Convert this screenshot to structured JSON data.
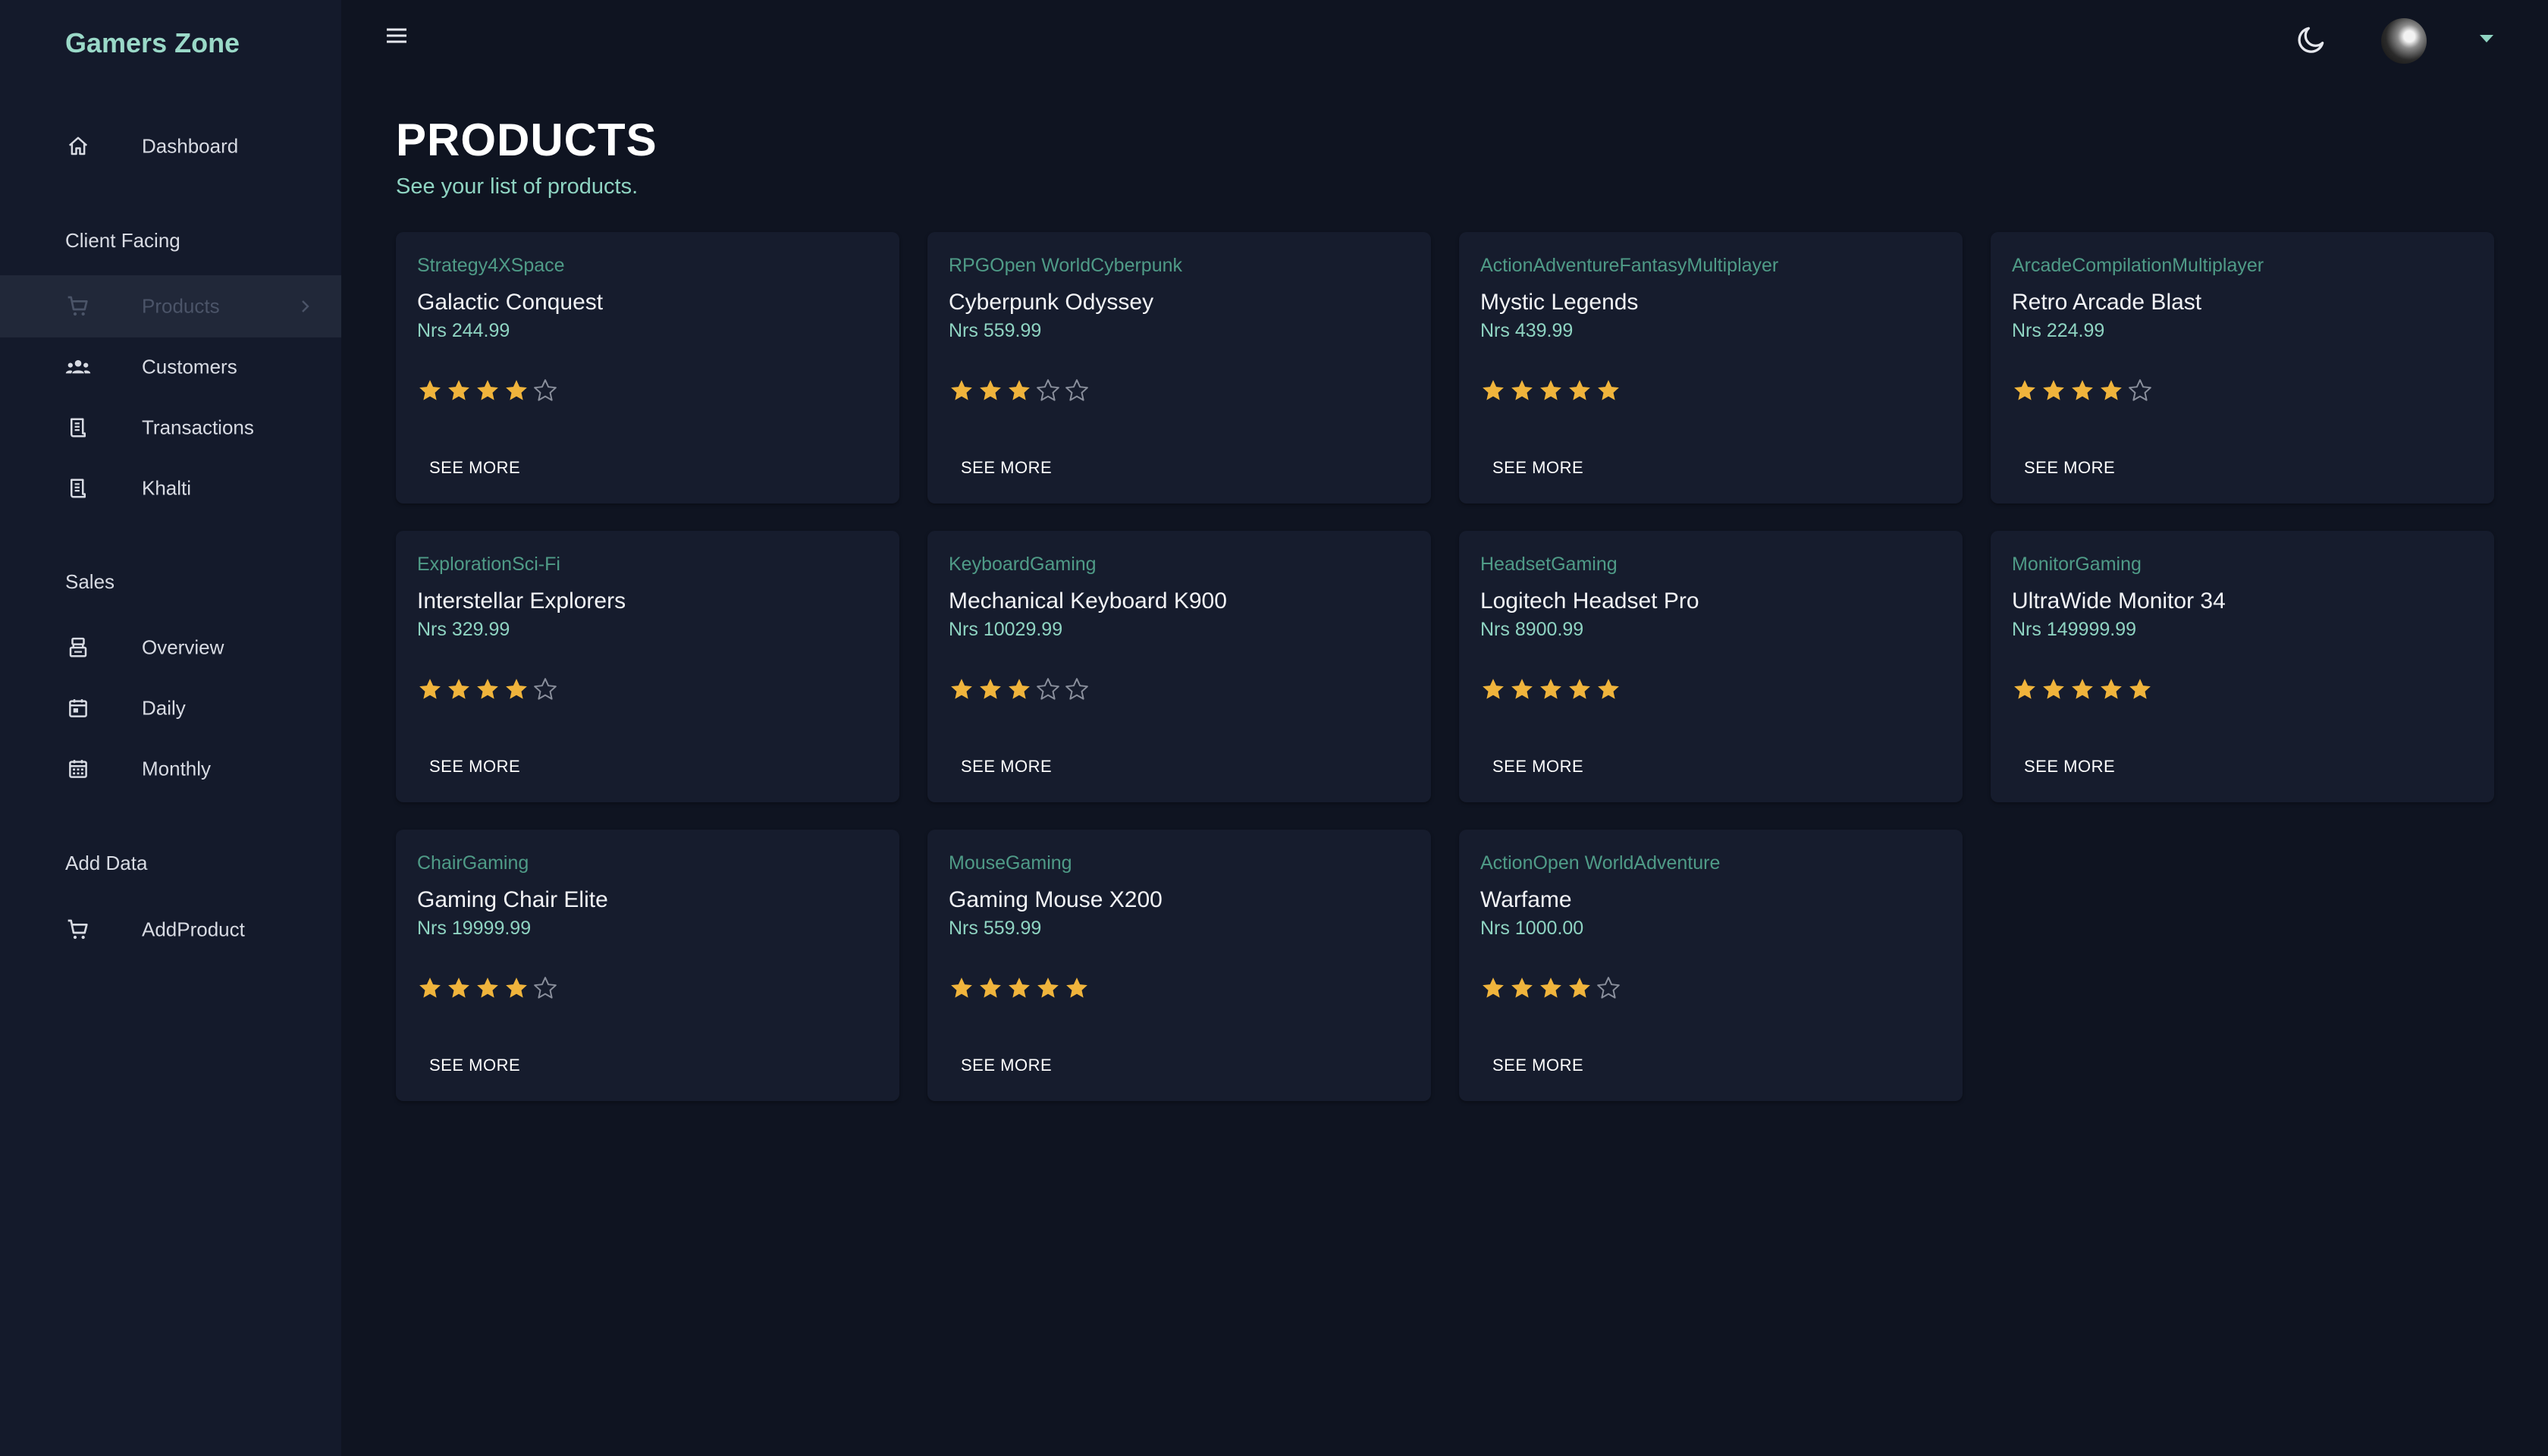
{
  "brand": "Gamers Zone",
  "sidebar": {
    "items": [
      {
        "label": "Dashboard"
      },
      {
        "section": "Client Facing"
      },
      {
        "label": "Products",
        "active": true
      },
      {
        "label": "Customers"
      },
      {
        "label": "Transactions"
      },
      {
        "label": "Khalti"
      },
      {
        "section": "Sales"
      },
      {
        "label": "Overview"
      },
      {
        "label": "Daily"
      },
      {
        "label": "Monthly"
      },
      {
        "section": "Add Data"
      },
      {
        "label": "AddProduct"
      }
    ]
  },
  "header": {
    "menu_icon": "hamburger-menu-icon",
    "theme_icon": "moon-icon",
    "avatar_caret_icon": "caret-down-icon"
  },
  "page": {
    "title": "PRODUCTS",
    "subtitle": "See your list of products."
  },
  "colors": {
    "background": "#0f1421",
    "sidebar": "#141a2b",
    "card": "#161c2d",
    "accent": "#8fd4c2",
    "category": "#4f9b87",
    "star": "#f0b43c"
  },
  "products": [
    {
      "category": "Strategy4XSpace",
      "name": "Galactic Conquest",
      "price": "Nrs 244.99",
      "rating": 4,
      "action": "SEE MORE"
    },
    {
      "category": "RPGOpen WorldCyberpunk",
      "name": "Cyberpunk Odyssey",
      "price": "Nrs 559.99",
      "rating": 3,
      "action": "SEE MORE"
    },
    {
      "category": "ActionAdventureFantasyMultiplayer",
      "name": "Mystic Legends",
      "price": "Nrs 439.99",
      "rating": 5,
      "action": "SEE MORE"
    },
    {
      "category": "ArcadeCompilationMultiplayer",
      "name": "Retro Arcade Blast",
      "price": "Nrs 224.99",
      "rating": 4,
      "action": "SEE MORE"
    },
    {
      "category": "ExplorationSci-Fi",
      "name": "Interstellar Explorers",
      "price": "Nrs 329.99",
      "rating": 4,
      "action": "SEE MORE"
    },
    {
      "category": "KeyboardGaming",
      "name": "Mechanical Keyboard K900",
      "price": "Nrs 10029.99",
      "rating": 3,
      "action": "SEE MORE"
    },
    {
      "category": "HeadsetGaming",
      "name": "Logitech Headset Pro",
      "price": "Nrs 8900.99",
      "rating": 5,
      "action": "SEE MORE"
    },
    {
      "category": "MonitorGaming",
      "name": "UltraWide Monitor 34",
      "price": "Nrs 149999.99",
      "rating": 5,
      "action": "SEE MORE"
    },
    {
      "category": "ChairGaming",
      "name": "Gaming Chair Elite",
      "price": "Nrs 19999.99",
      "rating": 4,
      "action": "SEE MORE"
    },
    {
      "category": "MouseGaming",
      "name": "Gaming Mouse X200",
      "price": "Nrs 559.99",
      "rating": 5,
      "action": "SEE MORE"
    },
    {
      "category": "ActionOpen WorldAdventure",
      "name": "Warfame",
      "price": "Nrs 1000.00",
      "rating": 4,
      "action": "SEE MORE"
    }
  ]
}
